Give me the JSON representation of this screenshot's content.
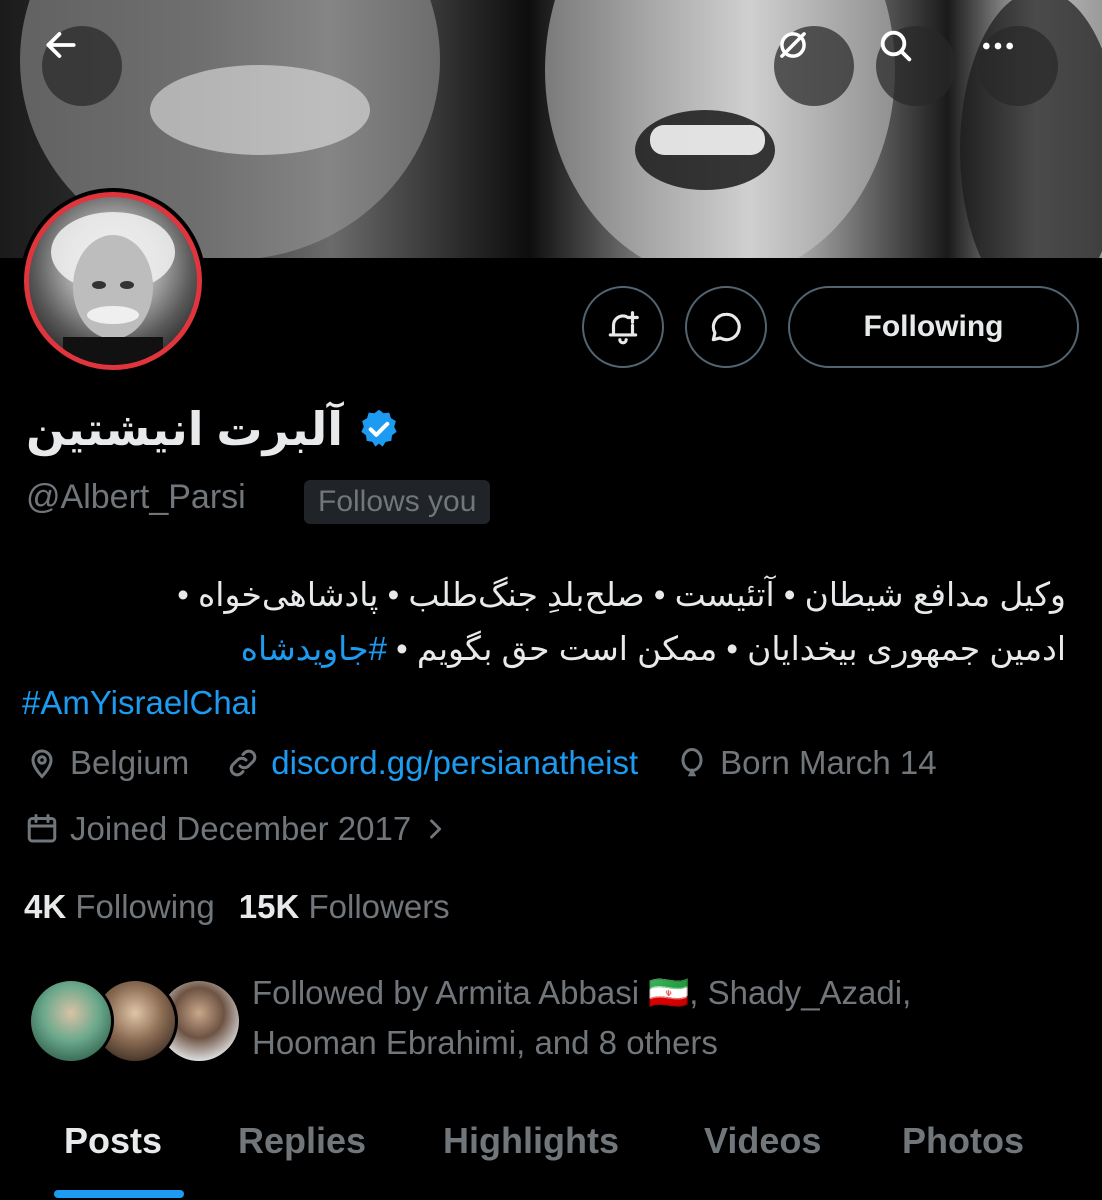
{
  "header": {
    "back_icon": "arrow-left-icon",
    "translate_icon": "translate-icon",
    "search_icon": "search-icon",
    "more_icon": "more-horizontal-icon"
  },
  "profile": {
    "display_name": "آلبرت انیشتین",
    "verified": true,
    "handle": "@Albert_Parsi",
    "follows_you_label": "Follows you",
    "following_button_label": "Following"
  },
  "bio": {
    "line1": "وکیل مدافع شیطان • آتئیست • صلح‌بلدِ جنگ‌طلب • پادشاهی‌خواه •",
    "line2_text": "ادمین جمهوری بیخدایان • ممکن است حق بگویم • ",
    "line2_hashtag": "#جاویدشاه",
    "line3_hashtag": "#AmYisraelChai"
  },
  "meta": {
    "location": "Belgium",
    "website": "discord.gg/persianatheist",
    "birthday": "Born March 14",
    "joined": "Joined December 2017"
  },
  "stats": {
    "following_count": "4K",
    "following_label": "Following",
    "followers_count": "15K",
    "followers_label": "Followers"
  },
  "followed_by": {
    "line1": "Followed by Armita Abbasi 🇮🇷, Shady_Azadi,",
    "line2": "Hooman Ebrahimi, and 8 others"
  },
  "tabs": [
    "Posts",
    "Replies",
    "Highlights",
    "Videos",
    "Photos"
  ],
  "colors": {
    "accent": "#1d9bf0",
    "avatar_ring": "#e0353d",
    "muted_text": "#71767b"
  }
}
